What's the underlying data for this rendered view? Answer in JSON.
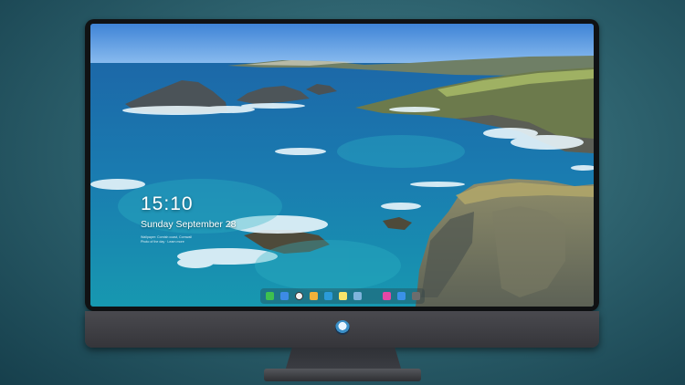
{
  "lockscreen": {
    "time": "15:10",
    "date": "Sunday September 28",
    "note_line1": "Wallpaper: Cornish coast, Cornwall",
    "note_line2": "Photo of the day · Learn more"
  },
  "dock": {
    "items": [
      {
        "name": "messages-icon",
        "color": "#3ec14f"
      },
      {
        "name": "finder-icon",
        "color": "#3d8be6"
      },
      {
        "name": "clock-icon",
        "color": "#f2f2f2"
      },
      {
        "name": "photos-icon",
        "color": "#f0b23a"
      },
      {
        "name": "video-icon",
        "color": "#2b9bd9"
      },
      {
        "name": "notes-icon",
        "color": "#f6e46a"
      },
      {
        "name": "preview-icon",
        "color": "#7fb4dc"
      },
      {
        "name": "itunes-icon",
        "color": "#e547a6"
      },
      {
        "name": "safari-icon",
        "color": "#3a91e8"
      },
      {
        "name": "camera-icon",
        "color": "#6d6d6d"
      }
    ]
  }
}
